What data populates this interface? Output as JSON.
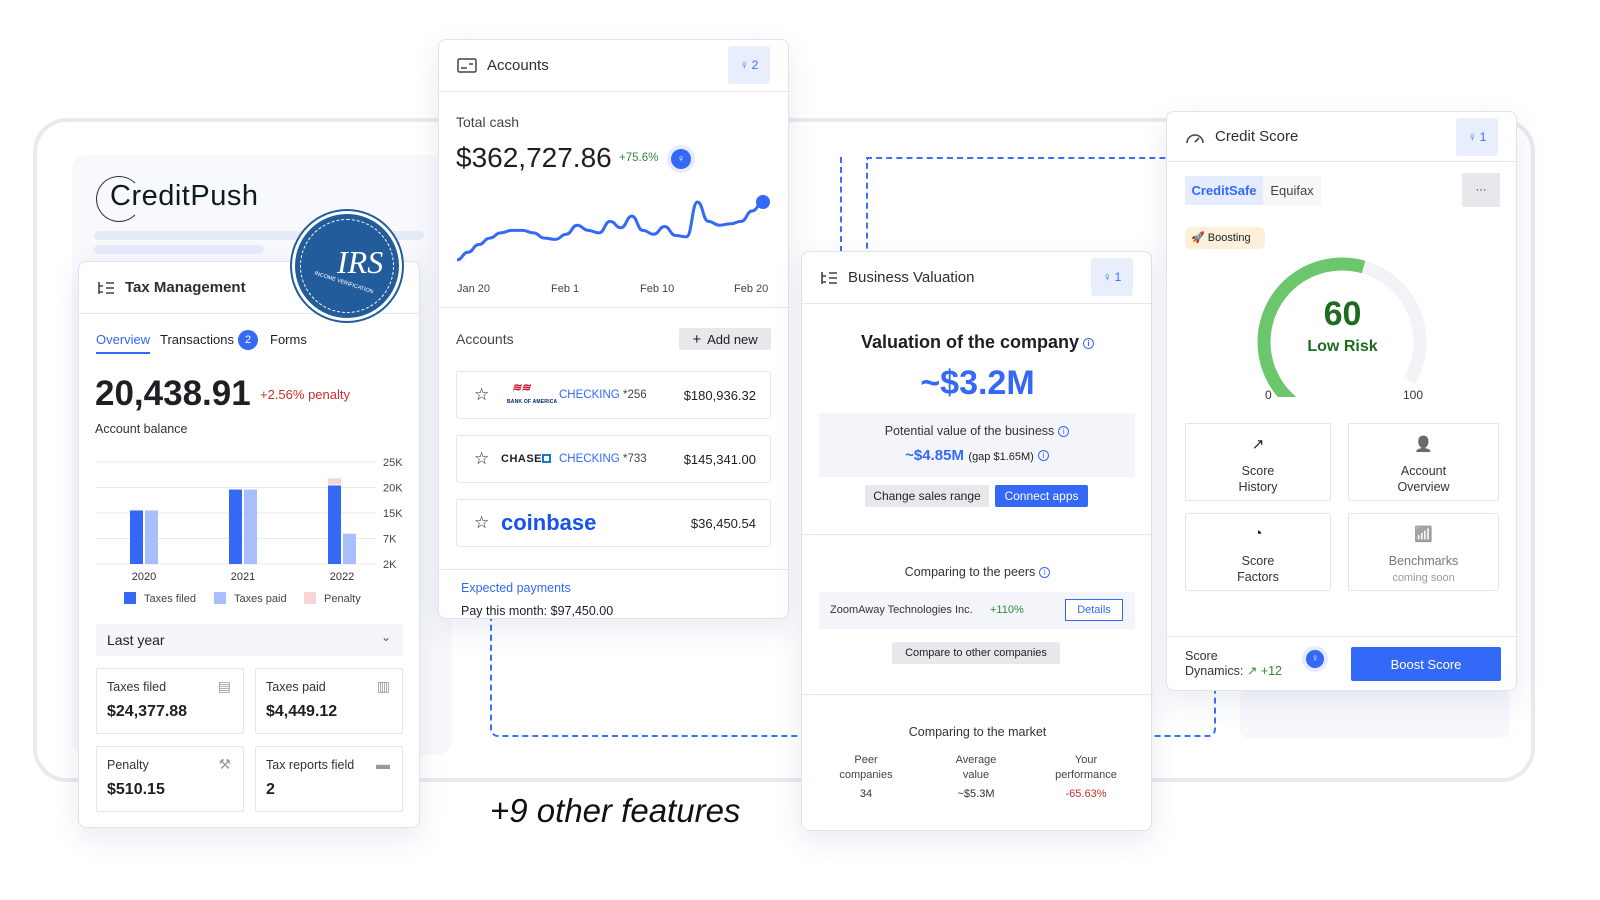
{
  "brand": {
    "logo": "CreditPush",
    "seal_text": "IRS INCOME VERIFICATION & TAX TRANSCRIPTS"
  },
  "tagline": "+9 other features",
  "tax": {
    "title": "Tax Management",
    "tabs": [
      {
        "label": "Overview",
        "active": true
      },
      {
        "label": "Transactions",
        "badge": "2"
      },
      {
        "label": "Forms"
      }
    ],
    "balance": "20,438.91",
    "penalty_note": "+2.56% penalty",
    "balance_label": "Account balance",
    "period": "Last year",
    "stats": [
      {
        "label": "Taxes filed",
        "value": "$24,377.88",
        "icon": "document-icon"
      },
      {
        "label": "Taxes paid",
        "value": "$4,449.12",
        "icon": "invoice-icon"
      },
      {
        "label": "Penalty",
        "value": "$510.15",
        "icon": "gavel-icon"
      },
      {
        "label": "Tax reports field",
        "value": "2",
        "icon": "folder-icon"
      }
    ]
  },
  "accounts": {
    "title": "Accounts",
    "insights": "2",
    "total_label": "Total cash",
    "total": "$362,727.86",
    "change": "+75.6%",
    "section": "Accounts",
    "add_new": "Add new",
    "rows": [
      {
        "bank": "Bank of America",
        "type": "CHECKING",
        "mask": "*256",
        "amount": "$180,936.32"
      },
      {
        "bank": "CHASE",
        "type": "CHECKING",
        "mask": "*733",
        "amount": "$145,341.00"
      },
      {
        "bank": "coinbase",
        "type": "",
        "mask": "",
        "amount": "$36,450.54"
      }
    ],
    "expected": "Expected payments",
    "pay_month": "Pay this month: $97,450.00"
  },
  "valuation": {
    "title": "Business Valuation",
    "insights": "1",
    "heading": "Valuation of the company",
    "value": "~$3.2M",
    "potential_label": "Potential value of the business",
    "potential": "~$4.85M",
    "gap": "(gap $1.65M)",
    "change_range": "Change sales range",
    "connect": "Connect apps",
    "peers_title": "Comparing to the peers",
    "peer_name": "ZoomAway Technologies Inc.",
    "peer_change": "+110%",
    "details": "Details",
    "compare": "Compare to other companies",
    "market_title": "Comparing to the market",
    "market": [
      {
        "label1": "Peer",
        "label2": "companies",
        "value": "34"
      },
      {
        "label1": "Average",
        "label2": "value",
        "value": "~$5.3M"
      },
      {
        "label1": "Your",
        "label2": "performance",
        "value": "-65.63%"
      }
    ]
  },
  "credit": {
    "title": "Credit Score",
    "insights": "1",
    "tabs": [
      "CreditSafe",
      "Equifax"
    ],
    "more": "···",
    "badge": "Boosting",
    "score": 60,
    "score_text": "60",
    "risk": "Low Risk",
    "min": "0",
    "max": "100",
    "tiles": [
      {
        "l1": "Score",
        "l2": "History"
      },
      {
        "l1": "Account",
        "l2": "Overview"
      },
      {
        "l1": "Score",
        "l2": "Factors"
      },
      {
        "l1": "Benchmarks",
        "l2": "coming soon"
      }
    ],
    "dyn1": "Score",
    "dyn2": "Dynamics:",
    "dyn_value": "+12",
    "boost": "Boost Score"
  },
  "colors": {
    "accent": "#3369f6",
    "filed": "#3369f6",
    "paid": "#a9bffb",
    "penalty": "#f8d4d4",
    "gauge": "#6cc76c",
    "positive": "#2e8b3a",
    "negative": "#c9302c"
  },
  "chart_data": [
    {
      "type": "bar",
      "categories": [
        "2020",
        "2021",
        "2022"
      ],
      "y_ticks": [
        "25K",
        "20K",
        "15K",
        "7K",
        "2K"
      ],
      "series": [
        {
          "name": "Taxes filed",
          "values": [
            15500,
            19600,
            20400
          ]
        },
        {
          "name": "Taxes paid",
          "values": [
            15500,
            19600,
            8500
          ]
        },
        {
          "name": "Penalty",
          "values": [
            0,
            0,
            1400
          ]
        }
      ],
      "legend": "bottom",
      "grid": true
    },
    {
      "type": "line",
      "x_ticks": [
        "Jan 20",
        "Feb 1",
        "Feb 10",
        "Feb 20"
      ],
      "values": [
        10,
        16,
        22,
        27,
        31,
        33,
        33,
        31,
        27,
        26,
        30,
        37,
        33,
        31,
        40,
        35,
        44,
        33,
        30,
        36,
        29,
        28,
        55,
        40,
        37,
        38,
        40,
        48,
        55
      ],
      "grid": false
    }
  ]
}
